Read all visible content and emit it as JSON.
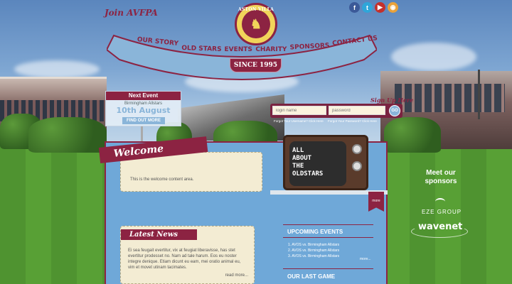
{
  "header": {
    "join_label": "Join AVFPA",
    "social": [
      {
        "icon": "facebook-icon",
        "glyph": "f"
      },
      {
        "icon": "twitter-icon",
        "glyph": "t"
      },
      {
        "icon": "youtube-icon",
        "glyph": "▶"
      },
      {
        "icon": "rss-icon",
        "glyph": "◉"
      }
    ],
    "crest_title": "ASTON VILLA",
    "crest_subtitle": "FORMER PLAYERS ASSOCIATION",
    "since": "SINCE 1995"
  },
  "nav": {
    "items": [
      "OUR STORY",
      "OLD STARS",
      "EVENTS",
      "CHARITY",
      "SPONSORS",
      "CONTACT US"
    ]
  },
  "event": {
    "heading": "Next Event",
    "name": "Birmingham Allstars",
    "date": "10th August",
    "button": "FIND OUT MORE"
  },
  "login": {
    "signup": "Sign Up Here",
    "username_placeholder": "login name",
    "password_placeholder": "password",
    "go_label": "GO",
    "forgot_username": "Forgot Your Username? Click Here",
    "forgot_password": "Forgot Your Password? Click Here"
  },
  "welcome": {
    "title": "Welcome",
    "text": "This is the welcome content area."
  },
  "tv": {
    "lines": [
      "ALL",
      "ABOUT",
      "THE",
      "OLDSTARS"
    ],
    "more": "more"
  },
  "news": {
    "title": "Latest News",
    "text": "Ei sea feugait evertitur, vix at feugiat liberavisse, has stet evertitur prodesset no. Nam ad tale harum. Eos eu noster integre denique. Etiam dicunt eu eam, mei oratio animal eu, vim et movet utinam tacimates.",
    "read_more": "read more..."
  },
  "upcoming": {
    "title": "UPCOMING EVENTS",
    "items": [
      "1. AVOS vs. Birmingham Allstars",
      "2. AVOS vs. Birmingham Allstars",
      "3. AVOS vs. Birmingham Allstars"
    ],
    "more": "more..."
  },
  "last_game": {
    "title": "OUR LAST GAME"
  },
  "sponsors": {
    "title_line1": "Meet our",
    "title_line2": "sponsors",
    "items": [
      "EZE GROUP",
      "wavenet"
    ]
  },
  "colors": {
    "claret": "#8c2342",
    "sky_blue": "#8ab5d9",
    "panel_blue": "#6fa8d8",
    "cream": "#f3ecd3"
  }
}
